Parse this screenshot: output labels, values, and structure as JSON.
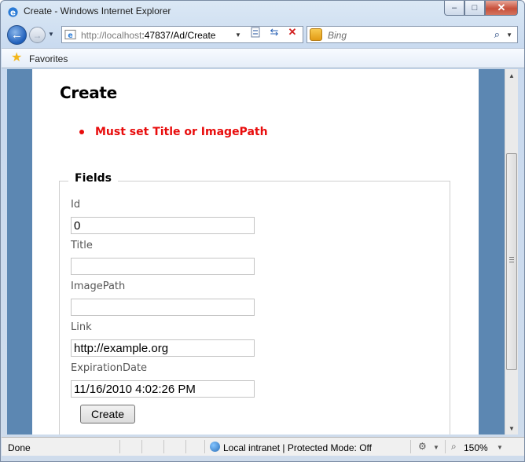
{
  "window": {
    "title": "Create - Windows Internet Explorer",
    "buttons": {
      "minimize": "–",
      "maximize": "□",
      "close": "✕"
    }
  },
  "nav": {
    "url_host": "http://localhost",
    "url_path": ":47837/Ad/Create",
    "search_placeholder": "Bing",
    "icons": [
      "back-arrow-icon",
      "forward-arrow-icon",
      "compatibility-view-icon",
      "refresh-icon",
      "stop-icon",
      "search-icon"
    ]
  },
  "favorites": {
    "label": "Favorites"
  },
  "page": {
    "title": "Create",
    "validation_messages": [
      "Must set Title or ImagePath"
    ],
    "fieldset_legend": "Fields",
    "fields": [
      {
        "label": "Id",
        "value": "0"
      },
      {
        "label": "Title",
        "value": ""
      },
      {
        "label": "ImagePath",
        "value": ""
      },
      {
        "label": "Link",
        "value": "http://example.org"
      },
      {
        "label": "ExpirationDate",
        "value": "11/16/2010 4:02:26 PM"
      }
    ],
    "submit_label": "Create"
  },
  "status": {
    "text": "Done",
    "zone": "Local intranet | Protected Mode: Off",
    "zoom": "150%"
  },
  "colors": {
    "error": "#e80c0c",
    "page_background": "#5c87b2"
  }
}
